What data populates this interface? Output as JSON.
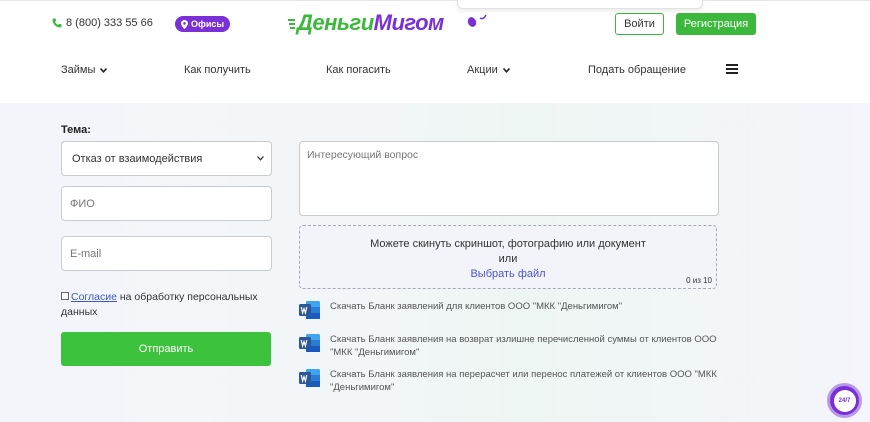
{
  "header": {
    "phone": "8 (800) 333 55 66",
    "offices_label": "Офисы",
    "logo_part1": "Деньги",
    "logo_part2": "Мигом",
    "login_label": "Войти",
    "register_label": "Регистрация"
  },
  "nav": {
    "items": [
      {
        "label": "Займы"
      },
      {
        "label": "Как получить"
      },
      {
        "label": "Как погасить"
      },
      {
        "label": "Акции"
      },
      {
        "label": "Подать обращение"
      }
    ]
  },
  "form": {
    "theme_label": "Тема:",
    "theme_selected": "Отказ от взаимодействия",
    "fio_placeholder": "ФИО",
    "email_placeholder": "E-mail",
    "consent_link": "Согласие",
    "consent_text": " на обработку персональных данных",
    "submit_label": "Отправить",
    "question_placeholder": "Интересующий вопрос",
    "dropzone_line1": "Можете скинуть скриншот, фотографию или документ",
    "dropzone_line2": "или",
    "dropzone_choose": "Выбрать файл",
    "dropzone_count": "0 из 10"
  },
  "documents": [
    {
      "text": "Скачать Бланк заявлений для клиентов ООО \"МКК \"Деньгимигом\""
    },
    {
      "text": "Скачать Бланк заявления на возврат излишне перечисленной суммы от клиентов ООО \"МКК \"Деньгимигом\""
    },
    {
      "text": "Скачать Бланк заявления на перерасчет или перенос платежей от клиентов ООО \"МКК \"Деньгимигом\""
    }
  ],
  "chat": {
    "label": "24/7"
  },
  "colors": {
    "green": "#3cb93c",
    "purple": "#7b2fd6",
    "word_blue": "#2b579a"
  }
}
